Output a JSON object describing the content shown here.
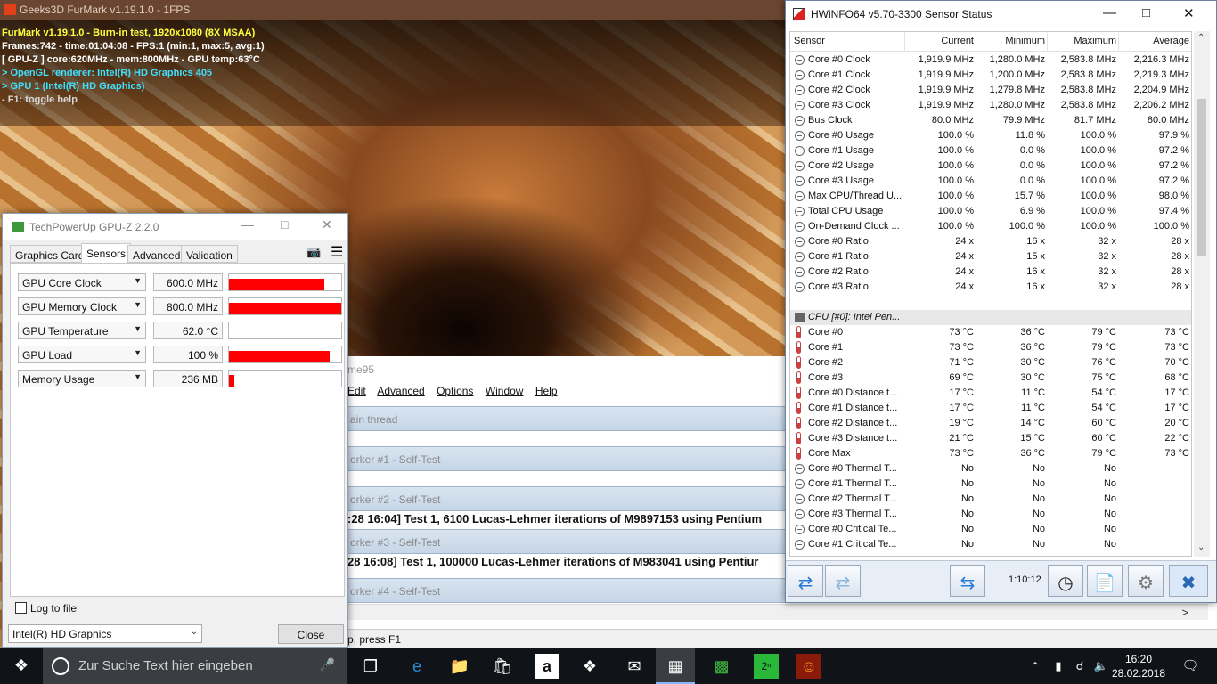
{
  "furmark": {
    "window_title": "Geeks3D FurMark v1.19.1.0 - 1FPS",
    "overlay": [
      {
        "text": "FurMark v1.19.1.0 - Burn-in test, 1920x1080 (8X MSAA)",
        "color": "yellow"
      },
      {
        "text": "Frames:742 - time:01:04:08 - FPS:1 (min:1, max:5, avg:1)",
        "color": "white"
      },
      {
        "text": "[ GPU-Z ] core:620MHz - mem:800MHz - GPU temp:63°C",
        "color": "white"
      },
      {
        "text": "> OpenGL renderer: Intel(R) HD Graphics 405",
        "color": "cyan"
      },
      {
        "text": "> GPU 1 (Intel(R) HD Graphics)",
        "color": "cyan"
      },
      {
        "text": "- F1: toggle help",
        "color": "gray"
      }
    ]
  },
  "prime95": {
    "title": "me95",
    "menu": [
      "Edit",
      "Advanced",
      "Options",
      "Window",
      "Help"
    ],
    "panes": [
      {
        "label": "ain thread"
      },
      {
        "label": "orker #1 - Self-Test"
      },
      {
        "label": "orker #2 - Self-Test",
        "text": ":28 16:04] Test 1, 6100 Lucas-Lehmer iterations of M9897153 using Pentium"
      },
      {
        "label": "orker #3 - Self-Test",
        "text": "28 16:08] Test 1, 100000 Lucas-Lehmer iterations of M983041 using Pentiur"
      },
      {
        "label": "orker #4 - Self-Test"
      }
    ],
    "status": "p, press F1"
  },
  "gpuz": {
    "title": "TechPowerUp GPU-Z 2.2.0",
    "tabs": [
      "Graphics Card",
      "Sensors",
      "Advanced",
      "Validation"
    ],
    "active_tab": "Sensors",
    "sensors": [
      {
        "name": "GPU Core Clock",
        "value": "600.0 MHz",
        "graph_level": 0.85
      },
      {
        "name": "GPU Memory Clock",
        "value": "800.0 MHz",
        "graph_level": 1.0
      },
      {
        "name": "GPU Temperature",
        "value": "62.0 °C",
        "graph_level": 0.0
      },
      {
        "name": "GPU Load",
        "value": "100 %",
        "graph_level": 0.9
      },
      {
        "name": "Memory Usage",
        "value": "236 MB",
        "graph_level": 0.05
      }
    ],
    "log_to_file": "Log to file",
    "device": "Intel(R) HD Graphics",
    "close": "Close"
  },
  "hwinfo": {
    "title": "HWiNFO64 v5.70-3300 Sensor Status",
    "columns": [
      "Sensor",
      "Current",
      "Minimum",
      "Maximum",
      "Average"
    ],
    "rows": [
      {
        "icon": "circle",
        "name": "Core #0 Clock",
        "cur": "1,919.9 MHz",
        "min": "1,280.0 MHz",
        "max": "2,583.8 MHz",
        "avg": "2,216.3 MHz"
      },
      {
        "icon": "circle",
        "name": "Core #1 Clock",
        "cur": "1,919.9 MHz",
        "min": "1,200.0 MHz",
        "max": "2,583.8 MHz",
        "avg": "2,219.3 MHz"
      },
      {
        "icon": "circle",
        "name": "Core #2 Clock",
        "cur": "1,919.9 MHz",
        "min": "1,279.8 MHz",
        "max": "2,583.8 MHz",
        "avg": "2,204.9 MHz"
      },
      {
        "icon": "circle",
        "name": "Core #3 Clock",
        "cur": "1,919.9 MHz",
        "min": "1,280.0 MHz",
        "max": "2,583.8 MHz",
        "avg": "2,206.2 MHz"
      },
      {
        "icon": "circle",
        "name": "Bus Clock",
        "cur": "80.0 MHz",
        "min": "79.9 MHz",
        "max": "81.7 MHz",
        "avg": "80.0 MHz"
      },
      {
        "icon": "circle",
        "name": "Core #0 Usage",
        "cur": "100.0 %",
        "min": "11.8 %",
        "max": "100.0 %",
        "avg": "97.9 %"
      },
      {
        "icon": "circle",
        "name": "Core #1 Usage",
        "cur": "100.0 %",
        "min": "0.0 %",
        "max": "100.0 %",
        "avg": "97.2 %"
      },
      {
        "icon": "circle",
        "name": "Core #2 Usage",
        "cur": "100.0 %",
        "min": "0.0 %",
        "max": "100.0 %",
        "avg": "97.2 %"
      },
      {
        "icon": "circle",
        "name": "Core #3 Usage",
        "cur": "100.0 %",
        "min": "0.0 %",
        "max": "100.0 %",
        "avg": "97.2 %"
      },
      {
        "icon": "circle",
        "name": "Max CPU/Thread U...",
        "cur": "100.0 %",
        "min": "15.7 %",
        "max": "100.0 %",
        "avg": "98.0 %"
      },
      {
        "icon": "circle",
        "name": "Total CPU Usage",
        "cur": "100.0 %",
        "min": "6.9 %",
        "max": "100.0 %",
        "avg": "97.4 %"
      },
      {
        "icon": "circle",
        "name": "On-Demand Clock ...",
        "cur": "100.0 %",
        "min": "100.0 %",
        "max": "100.0 %",
        "avg": "100.0 %"
      },
      {
        "icon": "circle",
        "name": "Core #0 Ratio",
        "cur": "24 x",
        "min": "16 x",
        "max": "32 x",
        "avg": "28 x"
      },
      {
        "icon": "circle",
        "name": "Core #1 Ratio",
        "cur": "24 x",
        "min": "15 x",
        "max": "32 x",
        "avg": "28 x"
      },
      {
        "icon": "circle",
        "name": "Core #2 Ratio",
        "cur": "24 x",
        "min": "16 x",
        "max": "32 x",
        "avg": "28 x"
      },
      {
        "icon": "circle",
        "name": "Core #3 Ratio",
        "cur": "24 x",
        "min": "16 x",
        "max": "32 x",
        "avg": "28 x"
      },
      {
        "icon": "blank",
        "name": "",
        "cur": "",
        "min": "",
        "max": "",
        "avg": ""
      },
      {
        "icon": "group",
        "name": "CPU [#0]: Intel Pen...",
        "cur": "",
        "min": "",
        "max": "",
        "avg": ""
      },
      {
        "icon": "thermo",
        "name": "Core #0",
        "cur": "73 °C",
        "min": "36 °C",
        "max": "79 °C",
        "avg": "73 °C"
      },
      {
        "icon": "thermo",
        "name": "Core #1",
        "cur": "73 °C",
        "min": "36 °C",
        "max": "79 °C",
        "avg": "73 °C"
      },
      {
        "icon": "thermo",
        "name": "Core #2",
        "cur": "71 °C",
        "min": "30 °C",
        "max": "76 °C",
        "avg": "70 °C"
      },
      {
        "icon": "thermo",
        "name": "Core #3",
        "cur": "69 °C",
        "min": "30 °C",
        "max": "75 °C",
        "avg": "68 °C"
      },
      {
        "icon": "thermo",
        "name": "Core #0 Distance t...",
        "cur": "17 °C",
        "min": "11 °C",
        "max": "54 °C",
        "avg": "17 °C"
      },
      {
        "icon": "thermo",
        "name": "Core #1 Distance t...",
        "cur": "17 °C",
        "min": "11 °C",
        "max": "54 °C",
        "avg": "17 °C"
      },
      {
        "icon": "thermo",
        "name": "Core #2 Distance t...",
        "cur": "19 °C",
        "min": "14 °C",
        "max": "60 °C",
        "avg": "20 °C"
      },
      {
        "icon": "thermo",
        "name": "Core #3 Distance t...",
        "cur": "21 °C",
        "min": "15 °C",
        "max": "60 °C",
        "avg": "22 °C"
      },
      {
        "icon": "thermo",
        "name": "Core Max",
        "cur": "73 °C",
        "min": "36 °C",
        "max": "79 °C",
        "avg": "73 °C"
      },
      {
        "icon": "circle",
        "name": "Core #0 Thermal T...",
        "cur": "No",
        "min": "No",
        "max": "No",
        "avg": ""
      },
      {
        "icon": "circle",
        "name": "Core #1 Thermal T...",
        "cur": "No",
        "min": "No",
        "max": "No",
        "avg": ""
      },
      {
        "icon": "circle",
        "name": "Core #2 Thermal T...",
        "cur": "No",
        "min": "No",
        "max": "No",
        "avg": ""
      },
      {
        "icon": "circle",
        "name": "Core #3 Thermal T...",
        "cur": "No",
        "min": "No",
        "max": "No",
        "avg": ""
      },
      {
        "icon": "circle",
        "name": "Core #0 Critical Te...",
        "cur": "No",
        "min": "No",
        "max": "No",
        "avg": ""
      },
      {
        "icon": "circle",
        "name": "Core #1 Critical Te...",
        "cur": "No",
        "min": "No",
        "max": "No",
        "avg": ""
      }
    ],
    "elapsed": "1:10:12"
  },
  "taskbar": {
    "search_placeholder": "Zur Suche Text hier eingeben",
    "time": "16:20",
    "date": "28.02.2018"
  }
}
